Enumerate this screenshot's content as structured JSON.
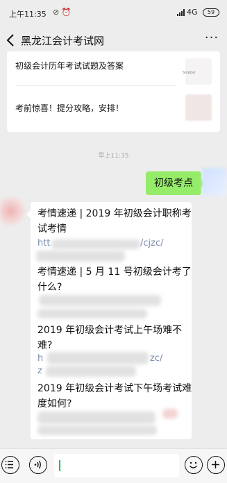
{
  "status_bar": {
    "time": "上午11:35",
    "network": "4G",
    "battery": "59"
  },
  "header": {
    "title": "黑龙江会计考试网",
    "more_label": "···"
  },
  "card": {
    "items": [
      {
        "title": "初级会计历年考试试题及答案"
      },
      {
        "title": "考前惊喜！提分攻略，安排！"
      }
    ],
    "thumb_text": "Sidebar"
  },
  "timestamp": "早上11:35",
  "outgoing_message": "初级考点",
  "incoming": {
    "lines": [
      "考情速递 | 2019 年初级会计职称考",
      "试考情",
      "考情速递 | 5 月 11 号初级会计考了",
      "什么?",
      "2019 年初级会计考试上午场难不",
      "难?",
      "2019 年初级会计考试下午场考试难",
      "度如何?"
    ],
    "link_fragments": [
      "htt",
      "/cjzc/",
      "h",
      "zc/",
      "z"
    ]
  }
}
